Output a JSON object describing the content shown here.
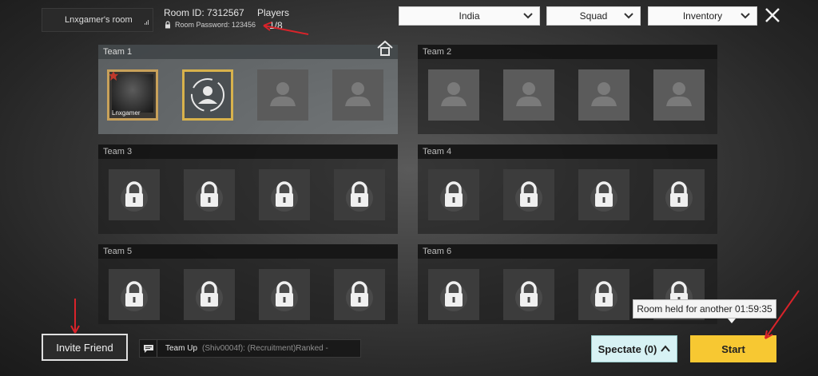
{
  "header": {
    "room_name": "Lnxgamer's room",
    "room_id": "Room ID: 7312567",
    "players_label": "Players",
    "players_count": "1/8",
    "room_password": "Room Password: 123456"
  },
  "filters": {
    "region": "India",
    "mode": "Squad",
    "inventory": "Inventory"
  },
  "teams": [
    {
      "name": "Team 1",
      "slots": [
        "player",
        "invite",
        "empty",
        "empty"
      ]
    },
    {
      "name": "Team 2",
      "slots": [
        "empty",
        "empty",
        "empty",
        "empty"
      ]
    },
    {
      "name": "Team 3",
      "slots": [
        "locked",
        "locked",
        "locked",
        "locked"
      ]
    },
    {
      "name": "Team 4",
      "slots": [
        "locked",
        "locked",
        "locked",
        "locked"
      ]
    },
    {
      "name": "Team 5",
      "slots": [
        "locked",
        "locked",
        "locked",
        "locked"
      ]
    },
    {
      "name": "Team 6",
      "slots": [
        "locked",
        "locked",
        "locked",
        "locked"
      ]
    }
  ],
  "player": {
    "name": "Lnxgamer"
  },
  "bottom": {
    "invite_label": "Invite Friend",
    "chat_prefix": "Team Up",
    "chat_message": "(Shiv0004f): (Recruitment)Ranked -",
    "spectate_label": "Spectate (0)",
    "start_label": "Start",
    "room_held": "Room held for another 01:59:35"
  },
  "colors": {
    "start": "#f7c832",
    "spectate": "#d7f2f4",
    "annotation_arrow": "#d9232a"
  }
}
